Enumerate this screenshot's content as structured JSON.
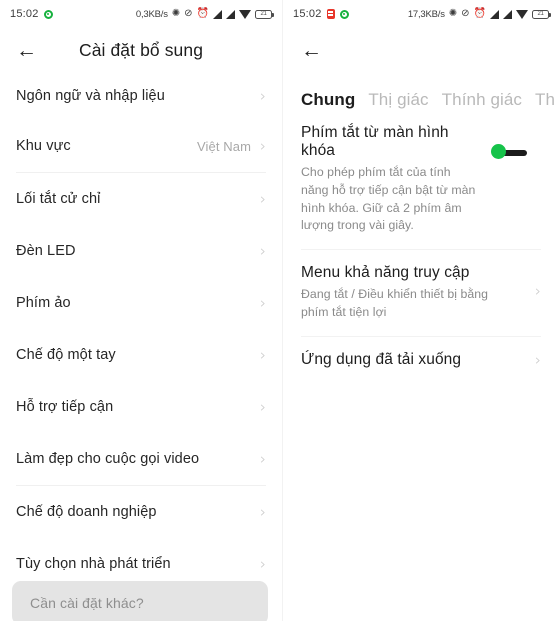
{
  "left": {
    "statusbar": {
      "time": "15:02",
      "icons_left": [
        "location-active-icon"
      ],
      "netspeed": "0,3KB/s",
      "icons_right": [
        "bluetooth-icon",
        "mute-icon",
        "alarm-icon",
        "signal-icon",
        "signal-icon",
        "wifi-icon",
        "battery-icon"
      ],
      "battery_level": "21"
    },
    "header": {
      "back": "←",
      "title": "Cài đặt bổ sung"
    },
    "groups": [
      {
        "items": [
          {
            "label": "Ngôn ngữ và nhập liệu",
            "value": "",
            "chevron": "›"
          },
          {
            "label": "Khu vực",
            "value": "Việt Nam",
            "chevron": "›"
          }
        ]
      },
      {
        "items": [
          {
            "label": "Lối tắt cử chỉ",
            "value": "",
            "chevron": "›"
          },
          {
            "label": "Đèn LED",
            "value": "",
            "chevron": "›"
          },
          {
            "label": "Phím ảo",
            "value": "",
            "chevron": "›"
          },
          {
            "label": "Chế độ một tay",
            "value": "",
            "chevron": "›"
          },
          {
            "label": "Hỗ trợ tiếp cận",
            "value": "",
            "chevron": "›"
          },
          {
            "label": "Làm đẹp cho cuộc gọi video",
            "value": "",
            "chevron": "›"
          }
        ]
      },
      {
        "items": [
          {
            "label": "Chế độ doanh nghiệp",
            "value": "",
            "chevron": "›"
          },
          {
            "label": "Tùy chọn nhà phát triển",
            "value": "",
            "chevron": "›"
          }
        ]
      }
    ],
    "search_card": {
      "placeholder": "Cần cài đặt khác?"
    }
  },
  "right": {
    "statusbar": {
      "time": "15:02",
      "icons_left": [
        "sim-card-icon",
        "location-active-icon"
      ],
      "netspeed": "17,3KB/s",
      "icons_right": [
        "bluetooth-icon",
        "mute-icon",
        "alarm-icon",
        "signal-icon",
        "signal-icon",
        "wifi-icon",
        "battery-icon"
      ],
      "battery_level": "21"
    },
    "header": {
      "back": "←"
    },
    "tabs": [
      {
        "label": "Chung",
        "active": true
      },
      {
        "label": "Thị giác",
        "active": false
      },
      {
        "label": "Thính giác",
        "active": false
      },
      {
        "label": "Th",
        "active": false
      }
    ],
    "blocks": [
      {
        "title": "Phím tắt từ màn hình khóa",
        "subtitle": "Cho phép phím tắt của tính năng hỗ trợ tiếp cận bật từ màn hình khóa. Giữ cả 2 phím âm lượng trong vài giây.",
        "control": "toggle",
        "toggle_on": true
      },
      {
        "title": "Menu khả năng truy cập",
        "subtitle": "Đang tắt / Điều khiển thiết bị bằng phím tắt tiện lợi",
        "control": "chevron",
        "chevron": "›"
      },
      {
        "title": "Ứng dụng đã tải xuống",
        "subtitle": "",
        "control": "chevron",
        "chevron": "›"
      }
    ]
  },
  "colors": {
    "accent_green": "#16c34a",
    "status_green": "#17b13e",
    "status_red": "#e8352a",
    "text_primary": "#1d1d1d",
    "text_secondary": "#8a8a8a",
    "divider": "#f0f0f0",
    "card_bg": "#e4e4e4"
  }
}
